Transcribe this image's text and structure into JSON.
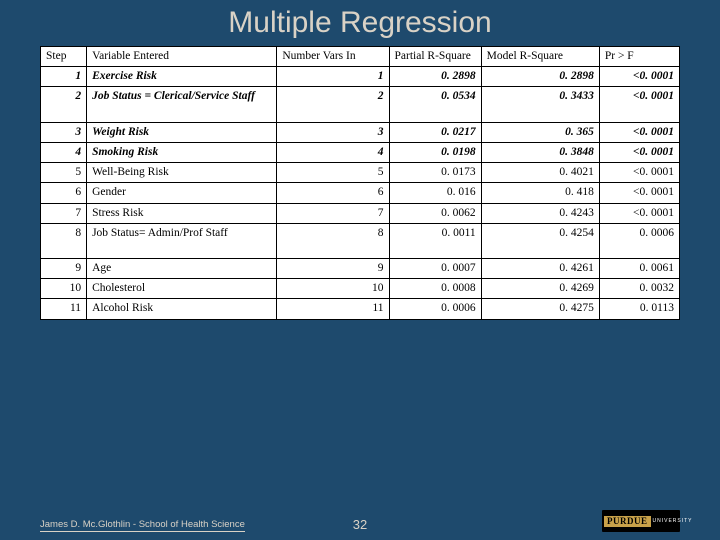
{
  "title": "Multiple Regression",
  "headers": {
    "step": "Step",
    "variable": "Variable Entered",
    "nvars": "Number Vars In",
    "prs": "Partial R-Square",
    "mrs": "Model R-Square",
    "pr": "Pr > F"
  },
  "rows": [
    {
      "step": "1",
      "variable": "Exercise Risk",
      "nvars": "1",
      "prs": "0. 2898",
      "mrs": "0. 2898",
      "pr": "<0. 0001",
      "bold": true,
      "tall": false
    },
    {
      "step": "2",
      "variable": "Job Status = Clerical/Service Staff",
      "nvars": "2",
      "prs": "0. 0534",
      "mrs": "0. 3433",
      "pr": "<0. 0001",
      "bold": true,
      "tall": true
    },
    {
      "step": "3",
      "variable": "Weight Risk",
      "nvars": "3",
      "prs": "0. 0217",
      "mrs": "0. 365",
      "pr": "<0. 0001",
      "bold": true,
      "tall": false
    },
    {
      "step": "4",
      "variable": "Smoking Risk",
      "nvars": "4",
      "prs": "0. 0198",
      "mrs": "0. 3848",
      "pr": "<0. 0001",
      "bold": true,
      "tall": false
    },
    {
      "step": "5",
      "variable": "Well-Being Risk",
      "nvars": "5",
      "prs": "0. 0173",
      "mrs": "0. 4021",
      "pr": "<0. 0001",
      "bold": false,
      "tall": false
    },
    {
      "step": "6",
      "variable": "Gender",
      "nvars": "6",
      "prs": "0. 016",
      "mrs": "0. 418",
      "pr": "<0. 0001",
      "bold": false,
      "tall": false
    },
    {
      "step": "7",
      "variable": "Stress Risk",
      "nvars": "7",
      "prs": "0. 0062",
      "mrs": "0. 4243",
      "pr": "<0. 0001",
      "bold": false,
      "tall": false
    },
    {
      "step": "8",
      "variable": "Job Status= Admin/Prof Staff",
      "nvars": "8",
      "prs": "0. 0011",
      "mrs": "0. 4254",
      "pr": "0. 0006",
      "bold": false,
      "tall": true
    },
    {
      "step": "9",
      "variable": "Age",
      "nvars": "9",
      "prs": "0. 0007",
      "mrs": "0. 4261",
      "pr": "0. 0061",
      "bold": false,
      "tall": false
    },
    {
      "step": "10",
      "variable": "Cholesterol",
      "nvars": "10",
      "prs": "0. 0008",
      "mrs": "0. 4269",
      "pr": "0. 0032",
      "bold": false,
      "tall": false
    },
    {
      "step": "11",
      "variable": "Alcohol Risk",
      "nvars": "11",
      "prs": "0. 0006",
      "mrs": "0. 4275",
      "pr": "0. 0113",
      "bold": false,
      "tall": false
    }
  ],
  "footer": {
    "author": "James D. Mc.Glothlin - School of Health Science",
    "page": "32",
    "logo_primary": "PURDUE",
    "logo_secondary": "UNIVERSITY"
  },
  "chart_data": {
    "type": "table",
    "title": "Multiple Regression",
    "columns": [
      "Step",
      "Variable Entered",
      "Number Vars In",
      "Partial R-Square",
      "Model R-Square",
      "Pr > F"
    ],
    "data": [
      [
        1,
        "Exercise Risk",
        1,
        0.2898,
        0.2898,
        "<0.0001"
      ],
      [
        2,
        "Job Status = Clerical/Service Staff",
        2,
        0.0534,
        0.3433,
        "<0.0001"
      ],
      [
        3,
        "Weight Risk",
        3,
        0.0217,
        0.365,
        "<0.0001"
      ],
      [
        4,
        "Smoking Risk",
        4,
        0.0198,
        0.3848,
        "<0.0001"
      ],
      [
        5,
        "Well-Being Risk",
        5,
        0.0173,
        0.4021,
        "<0.0001"
      ],
      [
        6,
        "Gender",
        6,
        0.016,
        0.418,
        "<0.0001"
      ],
      [
        7,
        "Stress Risk",
        7,
        0.0062,
        0.4243,
        "<0.0001"
      ],
      [
        8,
        "Job Status= Admin/Prof Staff",
        8,
        0.0011,
        0.4254,
        0.0006
      ],
      [
        9,
        "Age",
        9,
        0.0007,
        0.4261,
        0.0061
      ],
      [
        10,
        "Cholesterol",
        10,
        0.0008,
        0.4269,
        0.0032
      ],
      [
        11,
        "Alcohol Risk",
        11,
        0.0006,
        0.4275,
        0.0113
      ]
    ]
  }
}
